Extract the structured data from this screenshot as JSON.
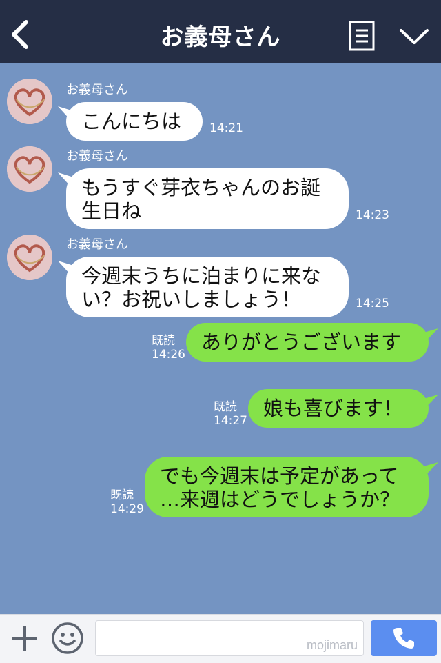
{
  "header": {
    "title": "お義母さん"
  },
  "messages": [
    {
      "sender": "お義母さん",
      "text_lines": [
        "こんにちは"
      ],
      "time": "14:21"
    },
    {
      "sender": "お義母さん",
      "text_lines": [
        "もうすぐ芽衣ちゃんのお誕",
        "生日ね"
      ],
      "time": "14:23"
    },
    {
      "sender": "お義母さん",
      "text_lines": [
        "今週末うちに泊まりに来な",
        "い？お祝いしましょう！"
      ],
      "time": "14:25"
    },
    {
      "read": "既読",
      "text_lines": [
        "ありがとうございます"
      ],
      "time": "14:26"
    },
    {
      "read": "既読",
      "text_lines": [
        "娘も喜びます！"
      ],
      "time": "14:27"
    },
    {
      "read": "既読",
      "text_lines": [
        "でも今週末は予定があって",
        "…来週はどうでしょうか？"
      ],
      "time": "14:29"
    }
  ],
  "footer": {
    "watermark": "mojimaru"
  },
  "colors": {
    "header_bg": "#252e45",
    "chat_bg": "#7494c2",
    "outgoing_bubble": "#85e249",
    "incoming_bubble": "#ffffff",
    "call_button": "#5b8ef0"
  },
  "icons": {
    "back": "back-chevron-icon",
    "menu": "list-menu-icon",
    "expand": "chevron-down-icon",
    "plus": "plus-icon",
    "emoji": "smiley-icon",
    "call": "phone-icon"
  }
}
